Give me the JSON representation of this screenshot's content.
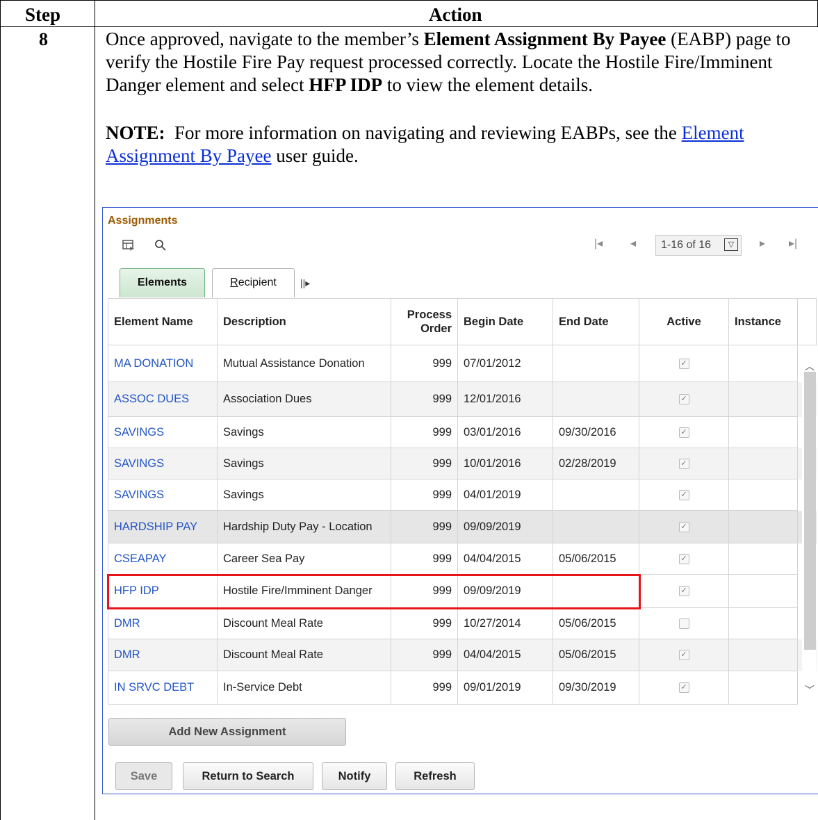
{
  "doc": {
    "col_step": "Step",
    "col_action": "Action",
    "step_number": "8",
    "para1": {
      "part1": "Once approved, navigate to the member’s ",
      "bold1": "Element Assignment By Payee",
      "part2": " (EABP) page to verify the Hostile Fire Pay request processed correctly. Locate the Hostile Fire/Imminent Danger element and select ",
      "bold2": "HFP IDP",
      "part3": " to view the element details."
    },
    "note": {
      "label": "NOTE:",
      "text": "  For more information on navigating and reviewing EABPs, see the ",
      "link": "Element Assignment By Payee",
      "tail": " user guide."
    }
  },
  "screen": {
    "title": "Assignments",
    "toolbar_icons": [
      "personalize-grid-icon",
      "search-icon"
    ],
    "pager": {
      "range": "1-16 of 16"
    },
    "tabs": {
      "elements": "Elements",
      "recipient_first": "R",
      "recipient_rest": "ecipient"
    },
    "columns": [
      "Element Name",
      "Description",
      "Process Order",
      "Begin Date",
      "End Date",
      "Active",
      "Instance"
    ],
    "rows": [
      {
        "name": "MA DONATION",
        "desc": "Mutual Assistance Donation",
        "order": "999",
        "begin": "07/01/2012",
        "end": "",
        "active": true
      },
      {
        "name": "ASSOC DUES",
        "desc": "Association Dues",
        "order": "999",
        "begin": "12/01/2016",
        "end": "",
        "active": true
      },
      {
        "name": "SAVINGS",
        "desc": "Savings",
        "order": "999",
        "begin": "03/01/2016",
        "end": "09/30/2016",
        "active": true
      },
      {
        "name": "SAVINGS",
        "desc": "Savings",
        "order": "999",
        "begin": "10/01/2016",
        "end": "02/28/2019",
        "active": true
      },
      {
        "name": "SAVINGS",
        "desc": "Savings",
        "order": "999",
        "begin": "04/01/2019",
        "end": "",
        "active": true
      },
      {
        "name": "HARDSHIP PAY",
        "desc": "Hardship Duty Pay - Location",
        "order": "999",
        "begin": "09/09/2019",
        "end": "",
        "active": true
      },
      {
        "name": "CSEAPAY",
        "desc": "Career Sea Pay",
        "order": "999",
        "begin": "04/04/2015",
        "end": "05/06/2015",
        "active": true
      },
      {
        "name": "HFP IDP",
        "desc": "Hostile Fire/Imminent Danger",
        "order": "999",
        "begin": "09/09/2019",
        "end": "",
        "active": true
      },
      {
        "name": "DMR",
        "desc": "Discount Meal Rate",
        "order": "999",
        "begin": "10/27/2014",
        "end": "05/06/2015",
        "active": false
      },
      {
        "name": "DMR",
        "desc": "Discount Meal Rate",
        "order": "999",
        "begin": "04/04/2015",
        "end": "05/06/2015",
        "active": true
      },
      {
        "name": "IN SRVC DEBT",
        "desc": "In-Service Debt",
        "order": "999",
        "begin": "09/01/2019",
        "end": "09/30/2019",
        "active": true
      }
    ],
    "highlight_color": "#e8141a",
    "buttons": {
      "add": "Add New Assignment",
      "save": "Save",
      "return": "Return to Search",
      "notify": "Notify",
      "refresh": "Refresh"
    }
  }
}
